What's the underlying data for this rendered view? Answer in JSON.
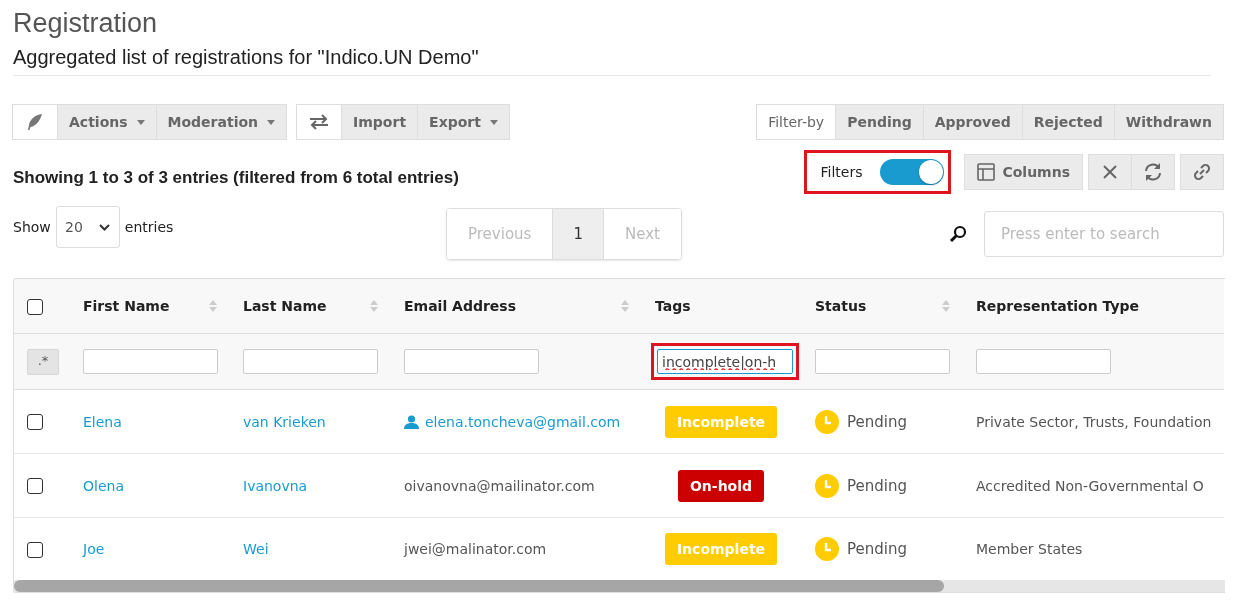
{
  "page": {
    "title": "Registration",
    "subtitle": "Aggregated list of registrations for \"Indico.UN Demo\""
  },
  "toolbar_left": [
    {
      "kind": "compose",
      "buttons": [
        {
          "label": "Actions",
          "dropdown": true
        },
        {
          "label": "Moderation",
          "dropdown": true
        }
      ]
    },
    {
      "kind": "transfer",
      "buttons": [
        {
          "label": "Import",
          "dropdown": false
        },
        {
          "label": "Export",
          "dropdown": true
        }
      ]
    }
  ],
  "filter_by": {
    "label": "Filter-by",
    "options": [
      {
        "label": "Pending",
        "selected": false
      },
      {
        "label": "Approved",
        "selected": false
      },
      {
        "label": "Rejected",
        "selected": false
      },
      {
        "label": "Withdrawn",
        "selected": false
      }
    ]
  },
  "summary": "Showing 1 to 3 of 3 entries (filtered from 6 total entries)",
  "filters_toggle": {
    "label": "Filters",
    "on": true
  },
  "columns_button": {
    "label": "Columns"
  },
  "show": {
    "prefix": "Show",
    "value": "20",
    "suffix": "entries"
  },
  "pagination": [
    {
      "label": "Previous",
      "kind": "nav",
      "disabled": true,
      "selected": false
    },
    {
      "label": "1",
      "kind": "page",
      "disabled": false,
      "selected": true
    },
    {
      "label": "Next",
      "kind": "nav",
      "disabled": true,
      "selected": false
    }
  ],
  "search": {
    "placeholder": "Press enter to search"
  },
  "table": {
    "regex_button": ".*",
    "select_all_checked": false,
    "columns": [
      {
        "label": "First Name",
        "sortable": true,
        "highlighted": false
      },
      {
        "label": "Last Name",
        "sortable": true,
        "highlighted": false
      },
      {
        "label": "Email Address",
        "sortable": true,
        "highlighted": false
      },
      {
        "label": "Tags",
        "sortable": false,
        "filter": "incomplete|on-h",
        "highlighted": true
      },
      {
        "label": "Status",
        "sortable": true,
        "highlighted": false
      },
      {
        "label": "Representation Type",
        "sortable": false,
        "highlighted": false
      }
    ],
    "rows": [
      {
        "checked": false,
        "first_name": "Elena",
        "last_name": "van Krieken",
        "email": "elena.toncheva@gmail.com",
        "email_verified": true,
        "tag": "Incomplete",
        "color": "#ffcc00",
        "status": "Pending",
        "representation": "Private Sector, Trusts, Foundation"
      },
      {
        "checked": false,
        "first_name": "Olena",
        "last_name": "Ivanovna",
        "email": "oivanovna@mailinator.com",
        "email_verified": false,
        "tag": "On-hold",
        "color": "#cc0000",
        "status": "Pending",
        "representation": "Accredited Non-Governmental O"
      },
      {
        "checked": false,
        "first_name": "Joe",
        "last_name": "Wei",
        "email": "jwei@malinator.com",
        "email_verified": false,
        "tag": "Incomplete",
        "color": "#ffcc00",
        "status": "Pending",
        "representation": "Member States"
      }
    ]
  }
}
